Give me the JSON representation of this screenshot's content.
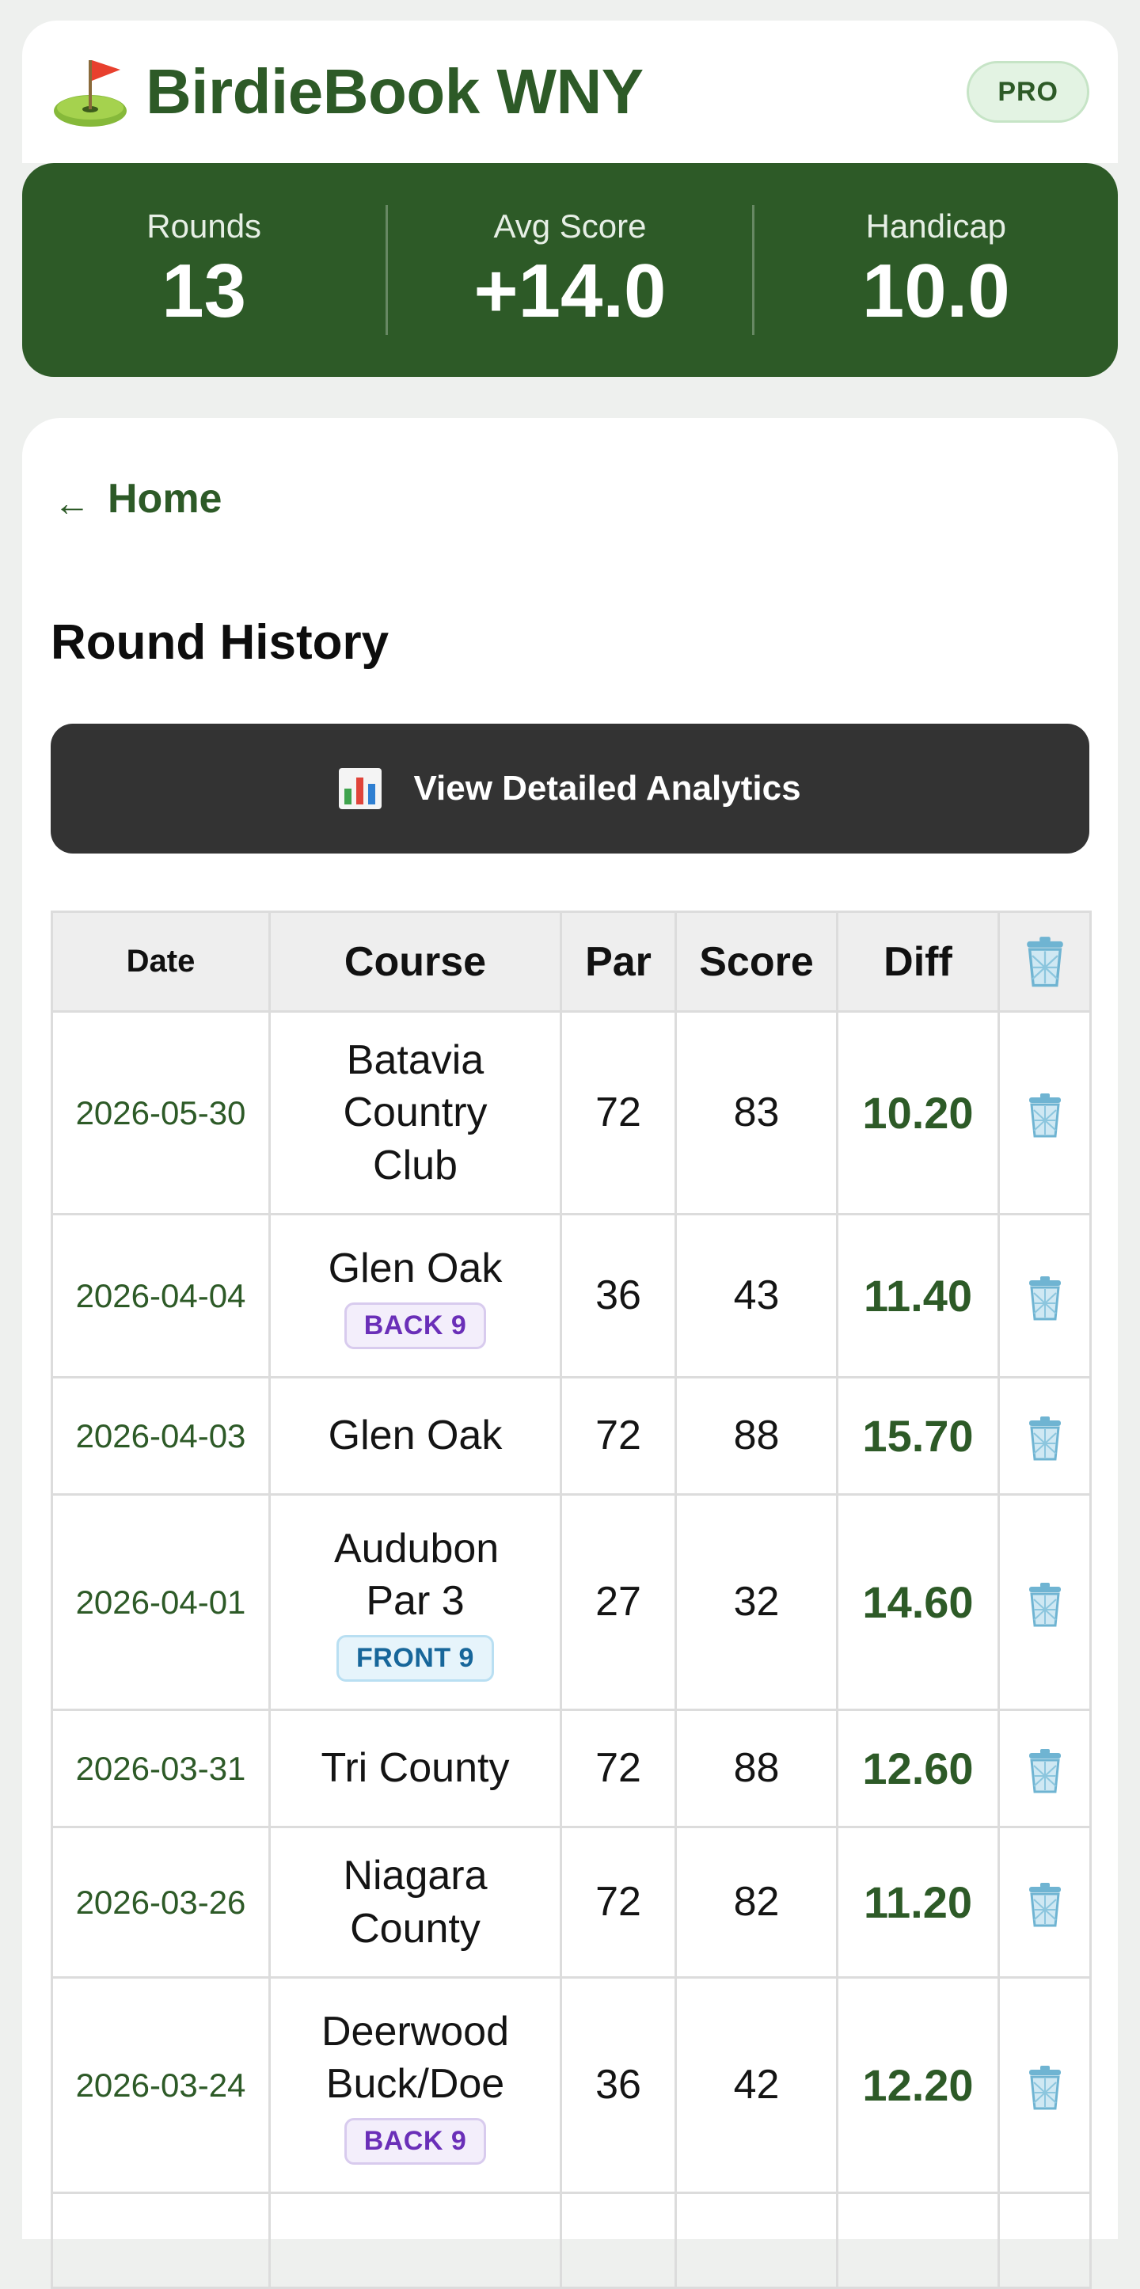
{
  "app": {
    "brand": "BirdieBook WNY",
    "logo_icon": "golf-flag-icon",
    "plan_badge": "PRO",
    "colors": {
      "brand_green": "#2d5a27",
      "dark_button": "#333333",
      "back9": "#6a2fb8",
      "front9": "#17669a"
    }
  },
  "stats": [
    {
      "label": "Rounds",
      "value": "13"
    },
    {
      "label": "Avg Score",
      "value": "+14.0"
    },
    {
      "label": "Handicap",
      "value": "10.0"
    }
  ],
  "nav": {
    "home_arrow": "←",
    "home_label": "Home"
  },
  "page": {
    "title": "Round History"
  },
  "analytics_button": {
    "icon": "bar-chart-icon",
    "label": "View Detailed Analytics"
  },
  "table": {
    "headers": {
      "date": "Date",
      "course": "Course",
      "par": "Par",
      "score": "Score",
      "diff": "Diff",
      "delete_icon": "trash-icon"
    },
    "rows": [
      {
        "date": "2026-05-30",
        "course": "Batavia Country Club",
        "badge": "",
        "par": "72",
        "score": "83",
        "diff": "10.20"
      },
      {
        "date": "2026-04-04",
        "course": "Glen Oak",
        "badge": "BACK 9",
        "par": "36",
        "score": "43",
        "diff": "11.40"
      },
      {
        "date": "2026-04-03",
        "course": "Glen Oak",
        "badge": "",
        "par": "72",
        "score": "88",
        "diff": "15.70"
      },
      {
        "date": "2026-04-01",
        "course": "Audubon Par 3",
        "badge": "FRONT 9",
        "par": "27",
        "score": "32",
        "diff": "14.60"
      },
      {
        "date": "2026-03-31",
        "course": "Tri County",
        "badge": "",
        "par": "72",
        "score": "88",
        "diff": "12.60"
      },
      {
        "date": "2026-03-26",
        "course": "Niagara County",
        "badge": "",
        "par": "72",
        "score": "82",
        "diff": "11.20"
      },
      {
        "date": "2026-03-24",
        "course": "Deerwood Buck/Doe",
        "badge": "BACK 9",
        "par": "36",
        "score": "42",
        "diff": "12.20"
      }
    ]
  }
}
